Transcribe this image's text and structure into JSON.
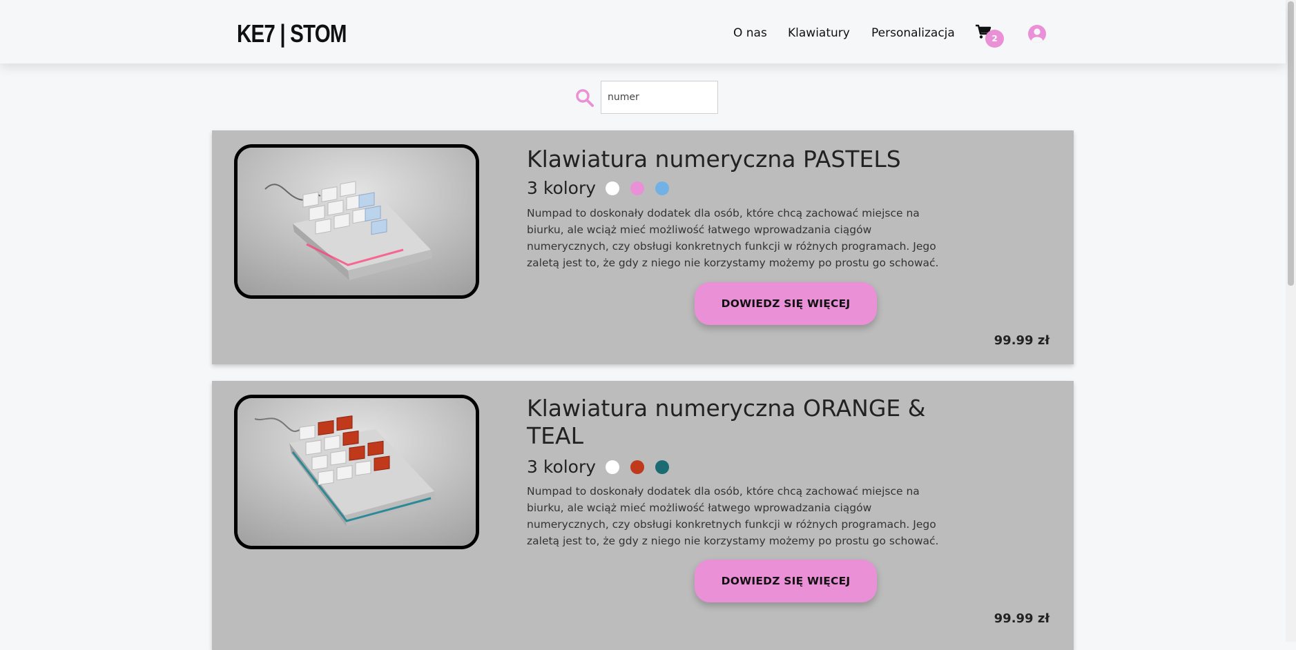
{
  "header": {
    "logo": "KE7 | STOM",
    "nav": [
      {
        "label": "O nas"
      },
      {
        "label": "Klawiatury"
      },
      {
        "label": "Personalizacja"
      }
    ],
    "cart_count": "2",
    "icons": {
      "cart": "cart-icon",
      "user": "user-icon",
      "search": "search-icon"
    },
    "accent_color": "#e990d7"
  },
  "search": {
    "value": "numer",
    "placeholder": ""
  },
  "products": [
    {
      "title": "Klawiatura numeryczna PASTELS",
      "colors_label": "3 kolory",
      "colors": [
        "#ffffff",
        "#e990d7",
        "#72b1e6"
      ],
      "description": "Numpad to doskonały dodatek dla osób, które chcą zachować miejsce na biurku, ale wciąż mieć możliwość łatwego wprowadzania ciągów numerycznych, czy obsługi konkretnych funkcji w różnych programach. Jego zaletą jest to, że gdy z niego nie korzystamy możemy po prostu go schować.",
      "button": "DOWIEDZ SIĘ WIĘCEJ",
      "price": "99.99 zł"
    },
    {
      "title": "Klawiatura numeryczna ORANGE & TEAL",
      "colors_label": "3 kolory",
      "colors": [
        "#ffffff",
        "#c0391b",
        "#1a6b72"
      ],
      "description": "Numpad to doskonały dodatek dla osób, które chcą zachować miejsce na biurku, ale wciąż mieć możliwość łatwego wprowadzania ciągów numerycznych, czy obsługi konkretnych funkcji w różnych programach. Jego zaletą jest to, że gdy z niego nie korzystamy możemy po prostu go schować.",
      "button": "DOWIEDZ SIĘ WIĘCEJ",
      "price": "99.99 zł"
    }
  ]
}
